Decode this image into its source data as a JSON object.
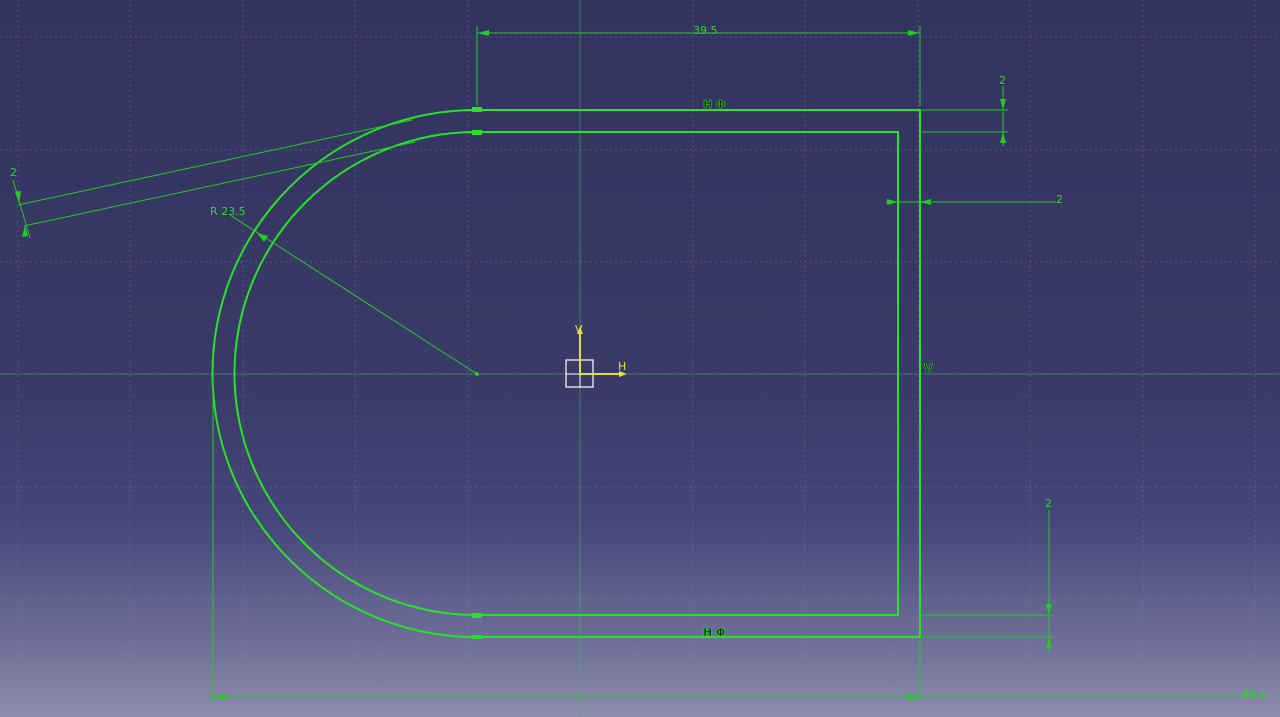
{
  "sketch": {
    "dimensions": {
      "width": "39.5",
      "radius": "R 23.5",
      "thickness_top": "2",
      "thickness_left": "2",
      "thickness_right": "2",
      "thickness_bottom": "2",
      "overall_length": "49.5"
    },
    "constraints": {
      "top_line": "H Φ",
      "bottom_line": "H Φ",
      "right_line": "V"
    },
    "axis": {
      "h_label": "H",
      "v_label": "V"
    },
    "colors": {
      "background_top": "#33335f",
      "background_bottom": "#8b8cab",
      "profile": "#27e327",
      "dimension": "#22cc22",
      "axis": "#e2e22a",
      "grid": "#8a8aa8"
    }
  }
}
